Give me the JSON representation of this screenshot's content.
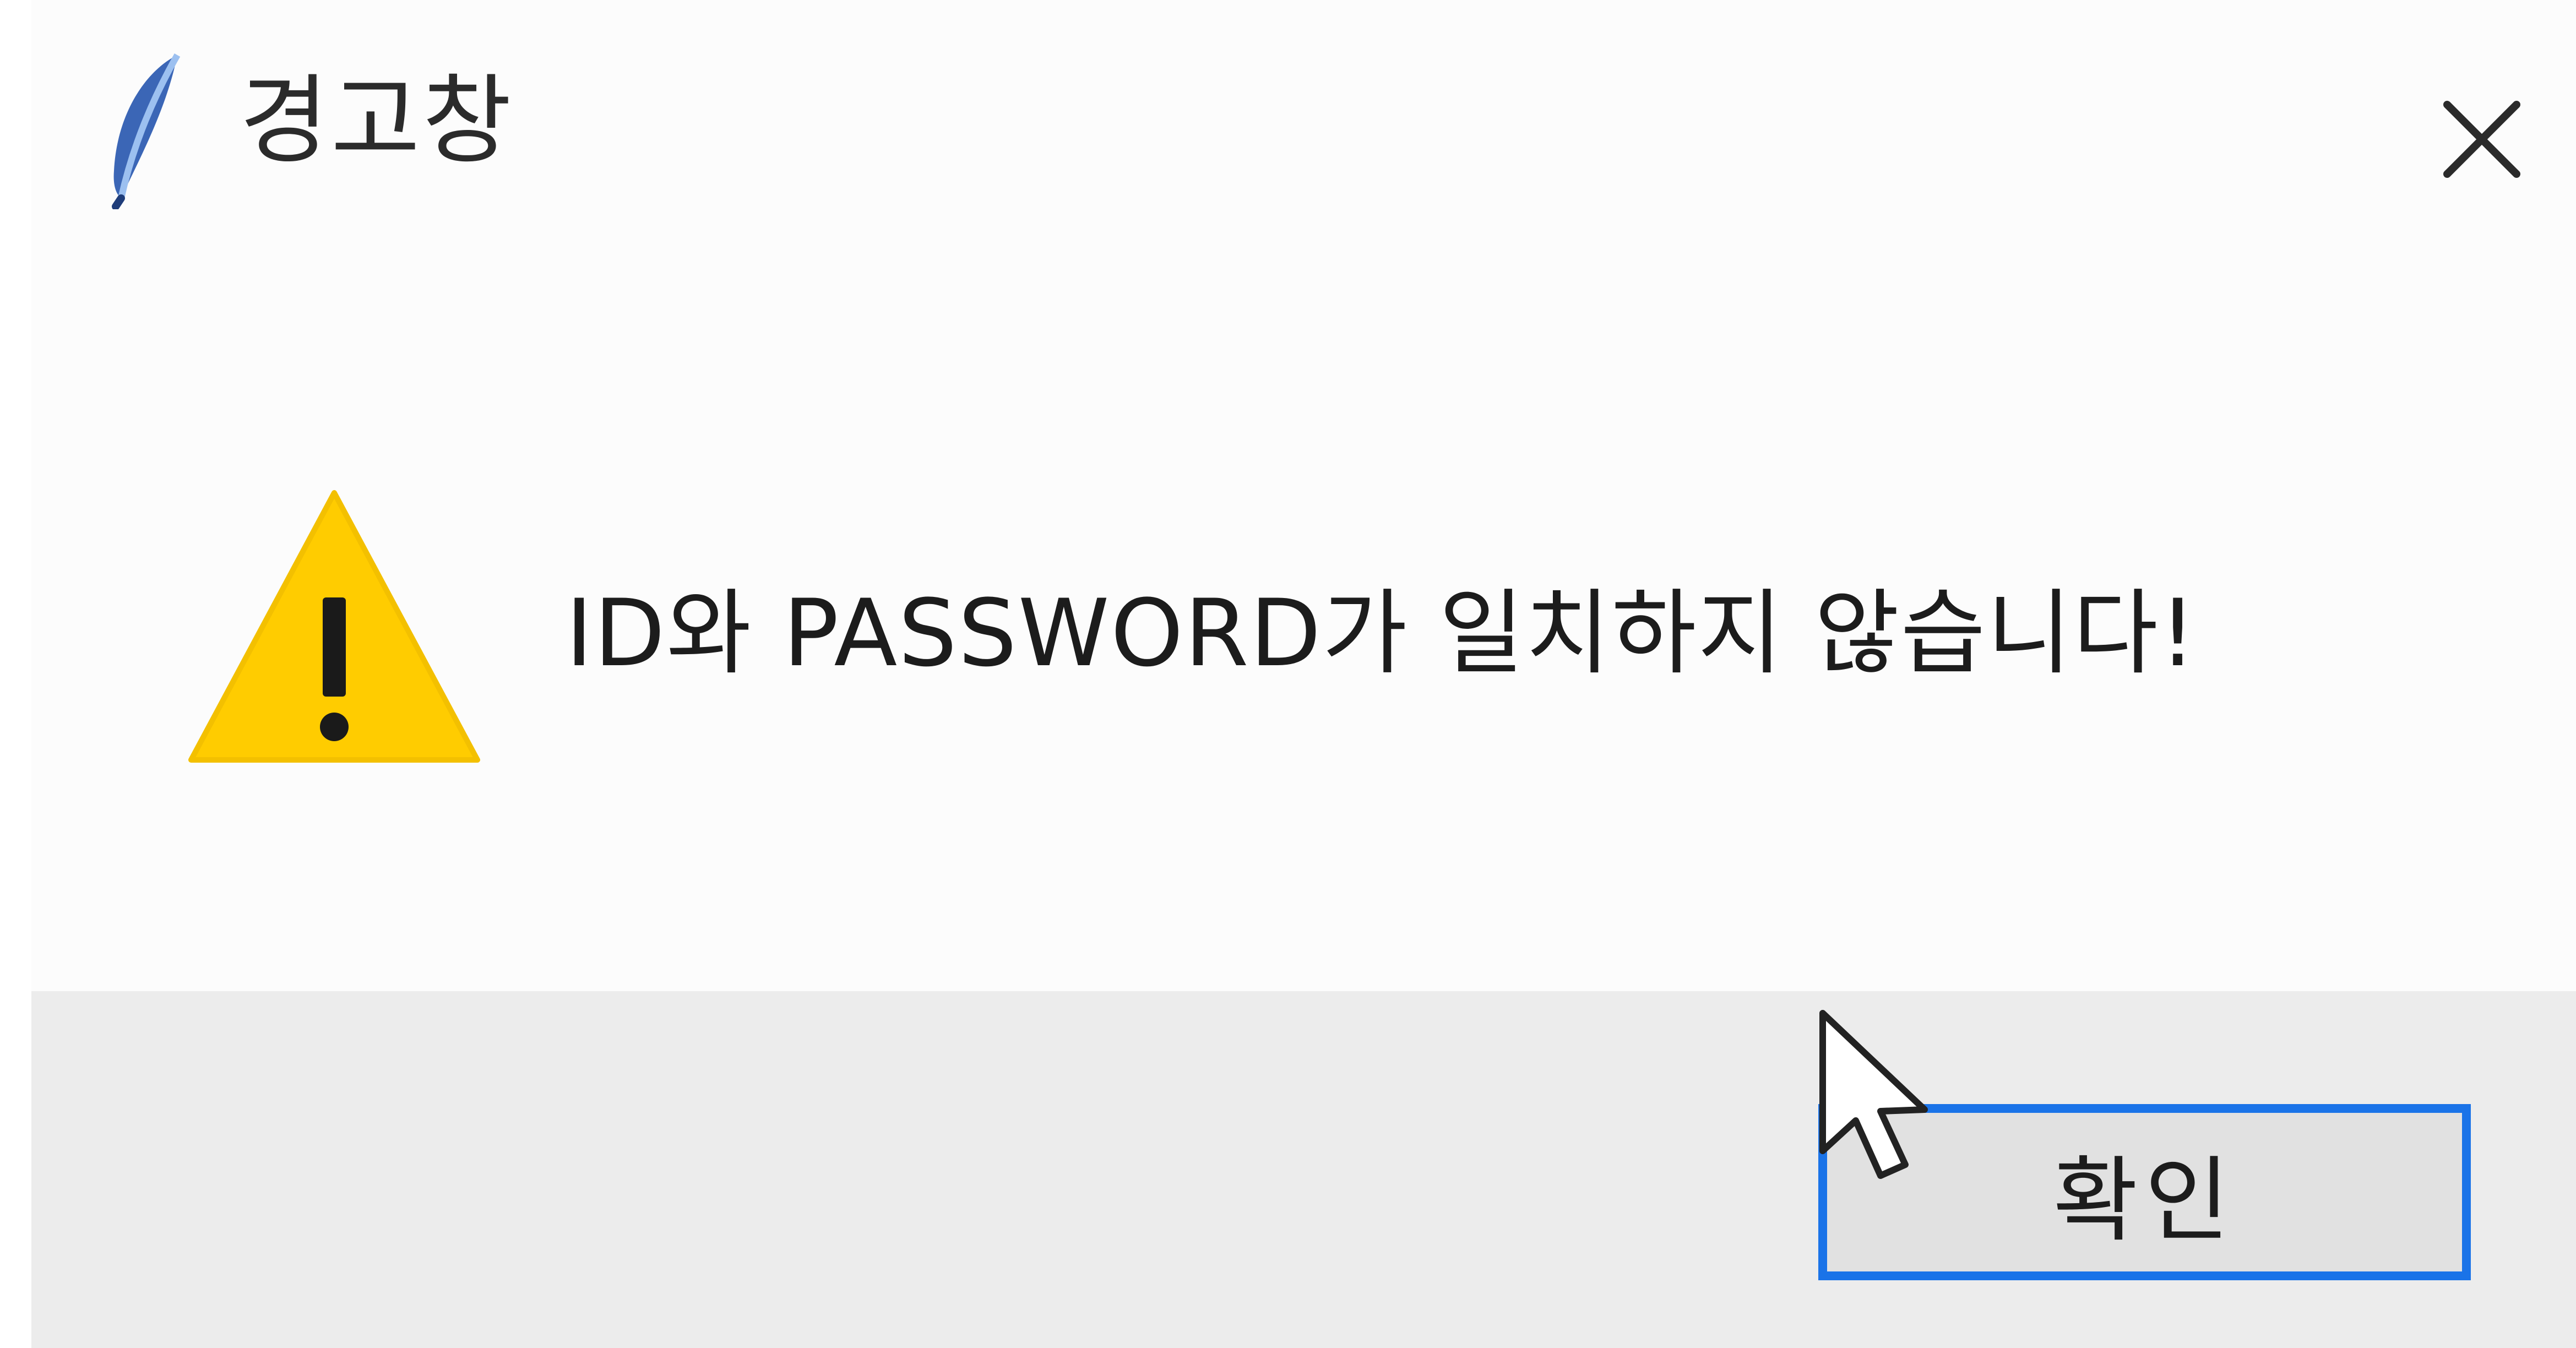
{
  "dialog": {
    "title": "경고창",
    "app_icon": "feather-icon",
    "close_icon": "close-icon",
    "warning_icon": "warning-triangle-icon",
    "message": "ID와 PASSWORD가 일치하지 않습니다!",
    "ok_label": "확인"
  },
  "colors": {
    "background": "#fcfcfc",
    "footer": "#ececec",
    "button_border": "#1a73e8",
    "warning": "#ffcc00"
  }
}
